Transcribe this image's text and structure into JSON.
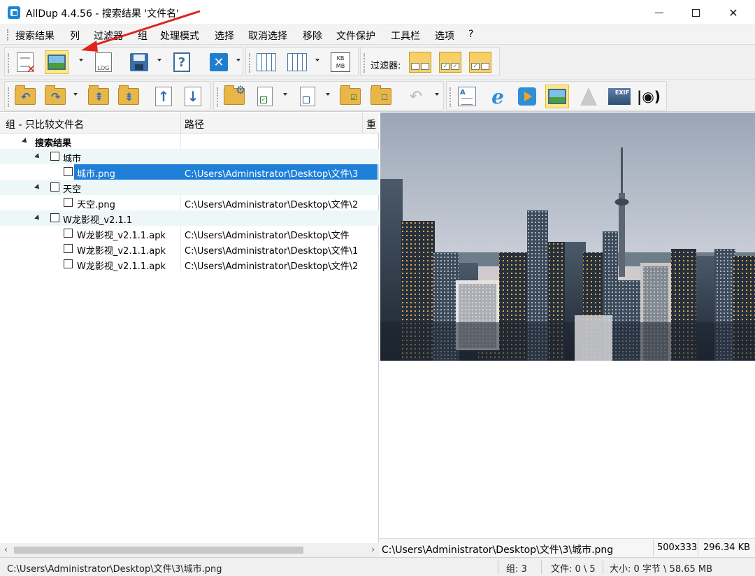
{
  "window": {
    "title": "AllDup 4.4.56 - 搜索结果 '文件名'",
    "minimize": "minimize",
    "maximize": "maximize",
    "close": "✕"
  },
  "menu": [
    "搜索结果",
    "列",
    "过滤器",
    "组",
    "处理模式",
    "选择",
    "取消选择",
    "移除",
    "文件保护",
    "工具栏",
    "选项",
    "?"
  ],
  "toolbar": {
    "log_label": "LOG",
    "kb_label": "KB",
    "mb_label": "MB",
    "filter_label": "过滤器:",
    "exif_label": "EXIF"
  },
  "columns": {
    "name": "组 - 只比较文件名",
    "path": "路径",
    "dup": "重"
  },
  "tree": {
    "root": "搜索结果",
    "groups": [
      {
        "name": "城市",
        "files": [
          {
            "name": "城市.png",
            "path": "C:\\Users\\Administrator\\Desktop\\文件\\3",
            "selected": true
          }
        ]
      },
      {
        "name": "天空",
        "files": [
          {
            "name": "天空.png",
            "path": "C:\\Users\\Administrator\\Desktop\\文件\\2",
            "selected": false
          }
        ]
      },
      {
        "name": "W龙影视_v2.1.1",
        "files": [
          {
            "name": "W龙影视_v2.1.1.apk",
            "path": "C:\\Users\\Administrator\\Desktop\\文件",
            "selected": false
          },
          {
            "name": "W龙影视_v2.1.1.apk",
            "path": "C:\\Users\\Administrator\\Desktop\\文件\\1",
            "selected": false
          },
          {
            "name": "W龙影视_v2.1.1.apk",
            "path": "C:\\Users\\Administrator\\Desktop\\文件\\2",
            "selected": false
          }
        ]
      }
    ]
  },
  "preview": {
    "path": "C:\\Users\\Administrator\\Desktop\\文件\\3\\城市.png",
    "dimensions": "500x333",
    "size": "296.34 KB"
  },
  "status": {
    "path": "C:\\Users\\Administrator\\Desktop\\文件\\3\\城市.png",
    "groups": "组: 3",
    "files": "文件: 0 \\ 5",
    "size": "大小: 0 字节 \\ 58.65 MB"
  },
  "colors": {
    "selection": "#1e7fd8",
    "group_row": "#edf7f7",
    "active_button": "#fde78a",
    "annotation_arrow": "#e0241b"
  }
}
